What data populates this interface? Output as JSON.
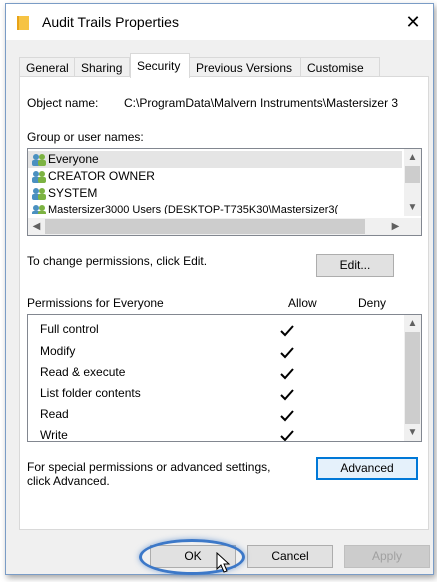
{
  "window": {
    "title": "Audit Trails Properties",
    "close_glyph": "✕"
  },
  "tabs": [
    {
      "label": "General"
    },
    {
      "label": "Sharing"
    },
    {
      "label": "Security",
      "active": true
    },
    {
      "label": "Previous Versions"
    },
    {
      "label": "Customise"
    }
  ],
  "security": {
    "object_name_label": "Object name:",
    "object_name_value": "C:\\ProgramData\\Malvern Instruments\\Mastersizer 3",
    "group_label": "Group or user names:",
    "users": [
      {
        "name": "Everyone",
        "selected": true
      },
      {
        "name": "CREATOR OWNER"
      },
      {
        "name": "SYSTEM"
      },
      {
        "name": "Mastersizer3000 Users (DESKTOP-T735K30\\Mastersizer3("
      }
    ],
    "change_text": "To change permissions, click Edit.",
    "edit_button": "Edit...",
    "perm_header": "Permissions for Everyone",
    "allow_header": "Allow",
    "deny_header": "Deny",
    "permissions": [
      {
        "name": "Full control",
        "allow": true
      },
      {
        "name": "Modify",
        "allow": true
      },
      {
        "name": "Read & execute",
        "allow": true
      },
      {
        "name": "List folder contents",
        "allow": true
      },
      {
        "name": "Read",
        "allow": true
      },
      {
        "name": "Write",
        "allow": true
      }
    ],
    "special_line1": "For special permissions or advanced settings,",
    "special_line2": "click Advanced.",
    "advanced_button": "Advanced"
  },
  "footer": {
    "ok": "OK",
    "cancel": "Cancel",
    "apply": "Apply"
  },
  "colors": {
    "accent": "#0078d7",
    "highlight": "#3c78c8"
  }
}
